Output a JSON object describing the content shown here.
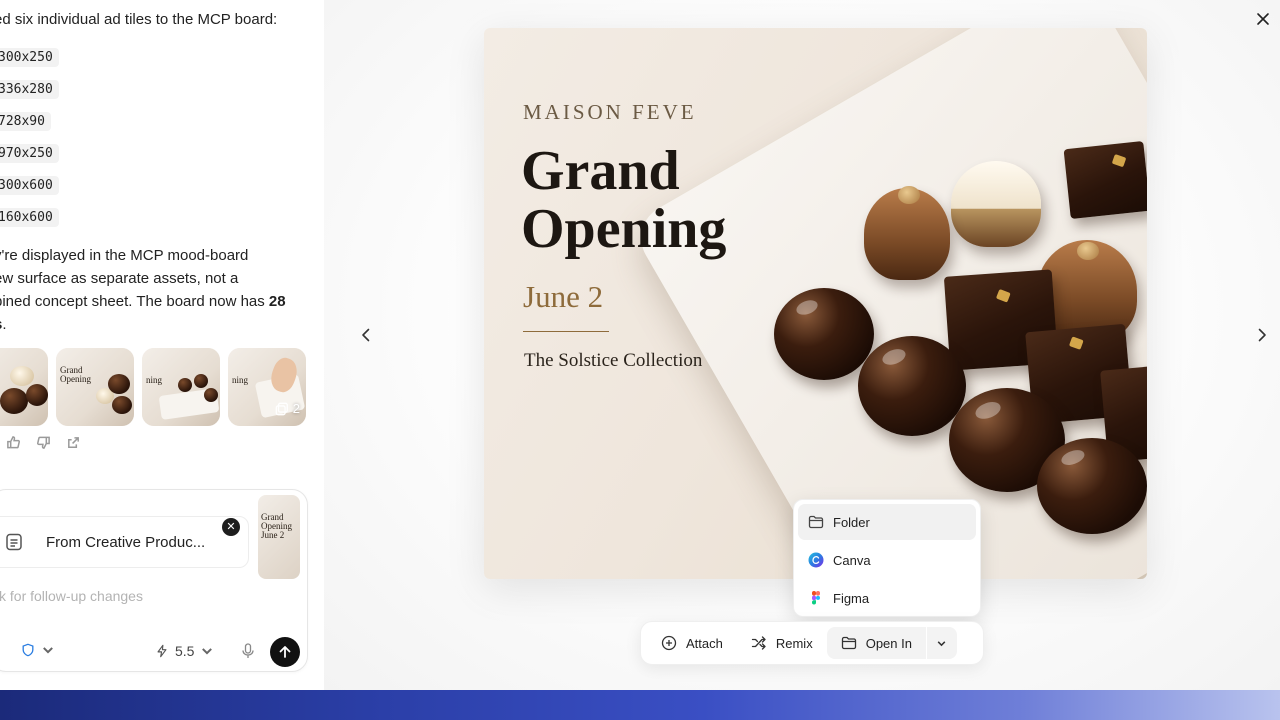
{
  "chat": {
    "intro": "ed six individual ad tiles to the MCP board:",
    "sizes": [
      "300x250",
      "336x280",
      "728x90",
      "970x250",
      "300x600",
      "160x600"
    ],
    "paragraph": {
      "line1": "y're displayed in the MCP mood-board",
      "line2": "ew surface as separate assets, not a",
      "line3_prefix": "bined concept sheet. The board now has ",
      "line3_bold": "28",
      "line4_bold": "s",
      "line4_suffix": "."
    },
    "thumbs": [
      {
        "text": ""
      },
      {
        "text": "Grand Opening"
      },
      {
        "text": "ning"
      },
      {
        "text": "ning"
      }
    ],
    "last_thumb_count": "2"
  },
  "composer": {
    "attachment_label": "From Creative Produc...",
    "thumb_text": "Grand Opening June 2",
    "placeholder": "k for follow-up changes",
    "model_value": "5.5"
  },
  "preview": {
    "ad": {
      "brand": "MAISON FEVE",
      "headline_line1": "Grand",
      "headline_line2": "Opening",
      "date": "June 2",
      "collection": "The Solstice Collection"
    },
    "menu": [
      {
        "label": "Folder",
        "icon": "folder-icon",
        "active": true
      },
      {
        "label": "Canva",
        "icon": "canva-icon",
        "active": false
      },
      {
        "label": "Figma",
        "icon": "figma-icon",
        "active": false
      }
    ],
    "toolbar": {
      "attach": "Attach",
      "remix": "Remix",
      "open_in": "Open In"
    }
  },
  "colors": {
    "accent_gold": "#8e6b3b",
    "send_button": "#111111",
    "canva_blue": "#2a7de1",
    "figma_red": "#f24e1e"
  }
}
